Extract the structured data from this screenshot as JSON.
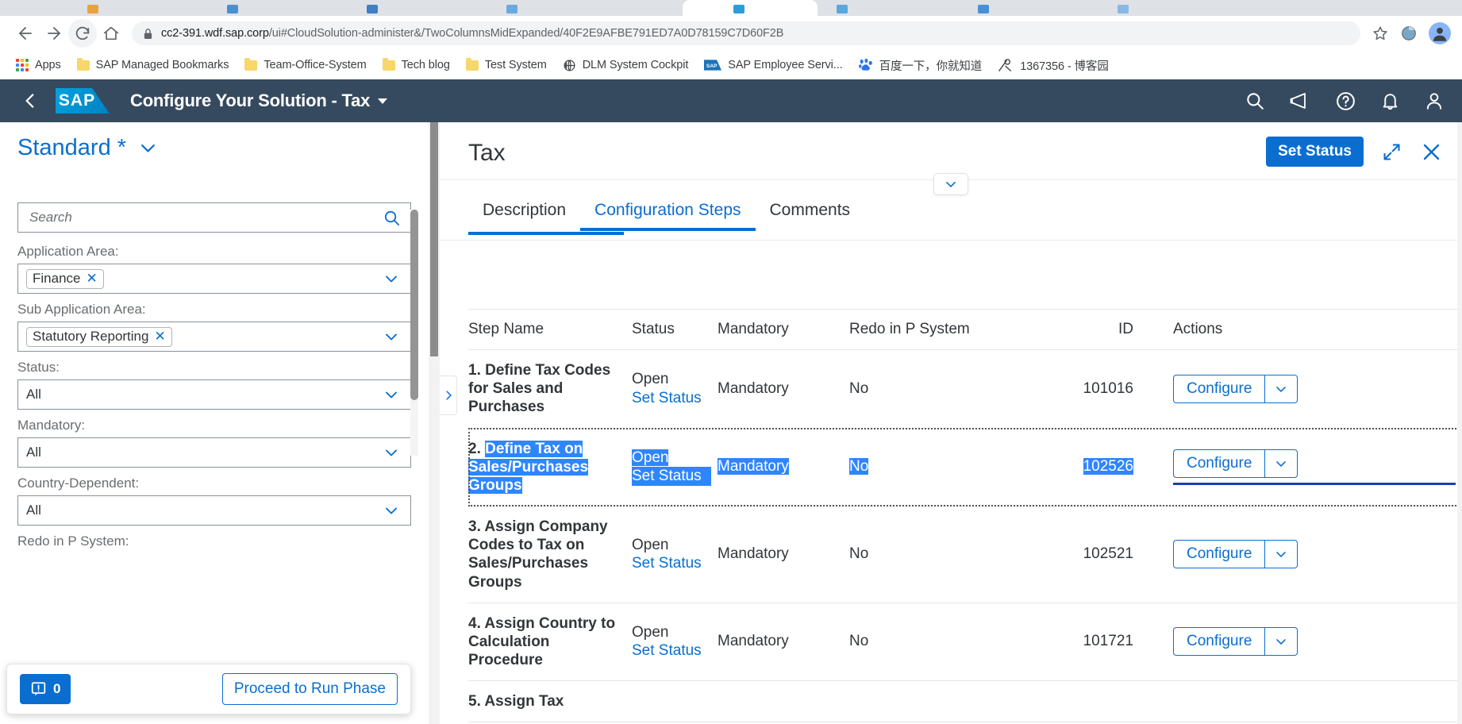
{
  "browser": {
    "nav": {
      "back": "←",
      "forward": "→",
      "reload": "⟳",
      "home": "⌂"
    },
    "url_host": "cc2-391.wdf.sap.corp",
    "url_path": "/ui#CloudSolution-administer&/TwoColumnsMidExpanded/40F2E9AFBE791ED7A0D78159C7D60F2B",
    "url_full": "cc2-391.wdf.sap.corp/ui#CloudSolution-administer&/TwoColumnsMidExpanded/40F2E9AFBE791ED7A0D78159C7D60F2B",
    "star_icon": "bookmark-star-icon",
    "profile_initial": "",
    "bookmarks": [
      {
        "label": "Apps",
        "icon": "apps-grid-icon"
      },
      {
        "label": "SAP Managed Bookmarks",
        "icon": "folder-icon"
      },
      {
        "label": "Team-Office-System",
        "icon": "folder-icon"
      },
      {
        "label": "Tech blog",
        "icon": "folder-icon"
      },
      {
        "label": "Test System",
        "icon": "folder-icon"
      },
      {
        "label": "DLM System Cockpit",
        "icon": "globe-icon"
      },
      {
        "label": "SAP Employee Servi...",
        "icon": "sap-icon"
      },
      {
        "label": "百度一下，你就知道",
        "icon": "baidu-icon"
      },
      {
        "label": "1367356 - 博客园",
        "icon": "cnblogs-icon"
      }
    ]
  },
  "shell": {
    "back_icon": "chevron-left-icon",
    "logo": "SAP",
    "title": "Configure Your Solution - Tax",
    "title_caret_icon": "caret-down-icon",
    "icons": [
      {
        "name": "search-icon"
      },
      {
        "name": "megaphone-icon"
      },
      {
        "name": "help-icon"
      },
      {
        "name": "bell-icon"
      },
      {
        "name": "user-icon"
      }
    ]
  },
  "left_panel": {
    "variant": "Standard *",
    "variant_caret_icon": "chevron-down-icon",
    "search": {
      "placeholder": "Search",
      "value": "",
      "icon": "search-icon"
    },
    "filters": [
      {
        "label": "Application Area:",
        "type": "token",
        "value": "Finance",
        "remove_icon": "×"
      },
      {
        "label": "Sub Application Area:",
        "type": "token",
        "value": "Statutory Reporting",
        "remove_icon": "×"
      },
      {
        "label": "Status:",
        "type": "text",
        "value": "All"
      },
      {
        "label": "Mandatory:",
        "type": "text",
        "value": "All"
      },
      {
        "label": "Country-Dependent:",
        "type": "text",
        "value": "All"
      },
      {
        "label": "Redo in P System:",
        "type": "text",
        "value": ""
      }
    ],
    "footer": {
      "message_count": "0",
      "message_icon": "message-popup-icon",
      "proceed_label": "Proceed to Run Phase"
    }
  },
  "main": {
    "title": "Tax",
    "set_status_label": "Set Status",
    "fullscreen_icon": "expand-icon",
    "close_icon": "close-icon",
    "collapse_icon": "chevron-down-icon",
    "expand_handle_icon": "chevron-right-icon",
    "tabs": [
      {
        "label": "Description",
        "active": false
      },
      {
        "label": "Configuration Steps",
        "active": true
      },
      {
        "label": "Comments",
        "active": false
      }
    ],
    "table": {
      "columns": [
        "Step Name",
        "Status",
        "Mandatory",
        "Redo in P System",
        "ID",
        "Actions"
      ],
      "action_label": "Configure",
      "action_caret_icon": "chevron-down-icon",
      "set_status_link": "Set Status",
      "rows": [
        {
          "step_name": "1. Define Tax Codes for Sales and Purchases",
          "status": "Open",
          "set_status": "Set Status",
          "mandatory": "Mandatory",
          "redo": "No",
          "id": "101016",
          "action": "Configure",
          "selected": false
        },
        {
          "step_name": "2. Define Tax on Sales/Purchases Groups",
          "status": "Open",
          "set_status": "Set Status",
          "mandatory": "Mandatory",
          "redo": "No",
          "id": "102526",
          "action": "Configure",
          "selected": true
        },
        {
          "step_name": "3. Assign Company Codes to Tax on Sales/Purchases Groups",
          "status": "Open",
          "set_status": "Set Status",
          "mandatory": "Mandatory",
          "redo": "No",
          "id": "102521",
          "action": "Configure",
          "selected": false
        },
        {
          "step_name": "4. Assign Country to Calculation Procedure",
          "status": "Open",
          "set_status": "Set Status",
          "mandatory": "Mandatory",
          "redo": "No",
          "id": "101721",
          "action": "Configure",
          "selected": false
        },
        {
          "step_name": "5. Assign Tax",
          "status": "",
          "set_status": "",
          "mandatory": "",
          "redo": "",
          "id": "",
          "action": "",
          "selected": false
        }
      ]
    }
  },
  "colors": {
    "sap_blue": "#0a6ed1",
    "shell_bg": "#354a5f",
    "selection": "#2e86ff",
    "logo_blue": "#008fd3"
  }
}
